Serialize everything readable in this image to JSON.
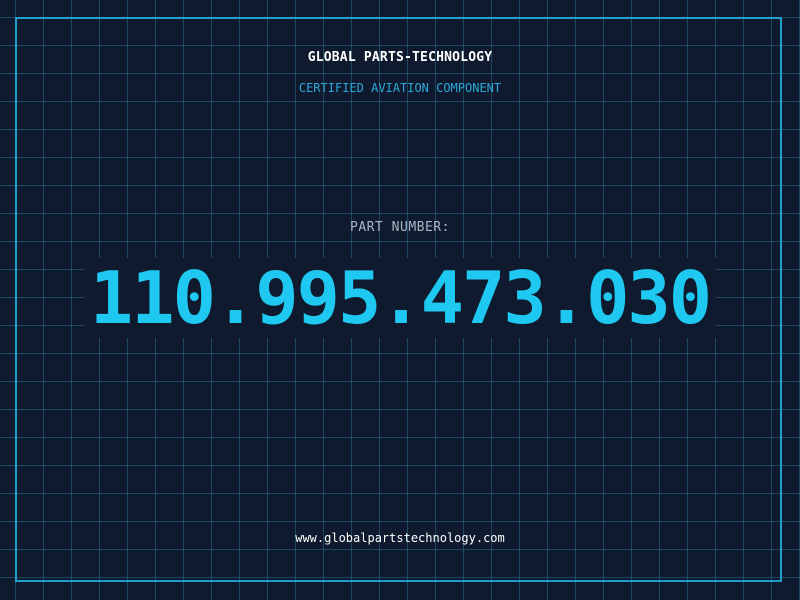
{
  "header": {
    "company": "GLOBAL PARTS-TECHNOLOGY",
    "subtitle": "CERTIFIED AVIATION COMPONENT"
  },
  "part": {
    "label": "PART NUMBER:",
    "number": "110.995.473.030"
  },
  "footer": {
    "url": "www.globalpartstechnology.com"
  },
  "colors": {
    "background": "#0f1a2e",
    "grid": "#266e8c",
    "accent": "#1ec8f0",
    "frame": "#1f9fc9",
    "label": "#a9b4c4"
  }
}
